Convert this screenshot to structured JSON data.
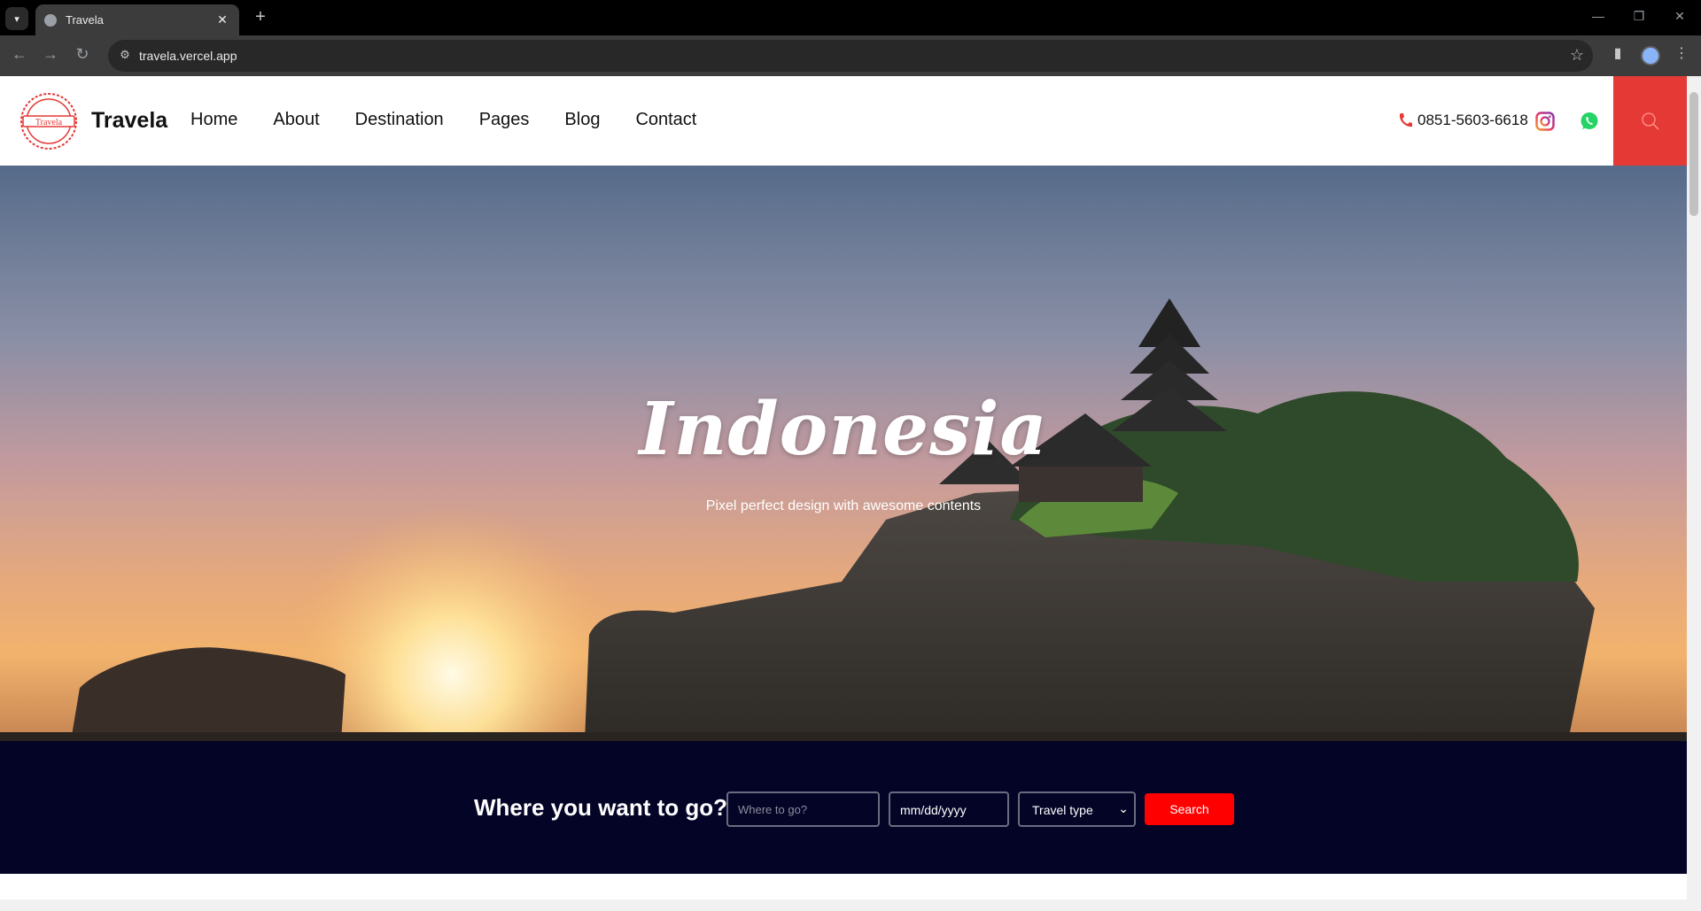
{
  "browser": {
    "tab_title": "Travela",
    "url": "travela.vercel.app",
    "new_tab_label": "+",
    "close_tab_label": "✕"
  },
  "header": {
    "logo_text": "Travela",
    "brand": "Travela",
    "menu": [
      {
        "label": "Home"
      },
      {
        "label": "About"
      },
      {
        "label": "Destination"
      },
      {
        "label": "Pages"
      },
      {
        "label": "Blog"
      },
      {
        "label": "Contact"
      }
    ],
    "phone": "0851-5603-6618",
    "icons": {
      "phone": "phone-icon",
      "instagram": "instagram-icon",
      "whatsapp": "whatsapp-icon",
      "search": "search-icon"
    }
  },
  "hero": {
    "title": "Indonesia",
    "subtitle": "Pixel perfect design with awesome contents"
  },
  "search_band": {
    "title": "Where you want to go?",
    "destination_placeholder": "Where to go?",
    "date_placeholder": "mm/dd/yyyy",
    "travel_type": "Travel type",
    "button": "Search"
  },
  "colors": {
    "accent_red": "#e53935",
    "search_band_bg": "#040427",
    "search_button": "#ff0000",
    "phone_icon": "#e53935",
    "whatsapp": "#25d366"
  }
}
